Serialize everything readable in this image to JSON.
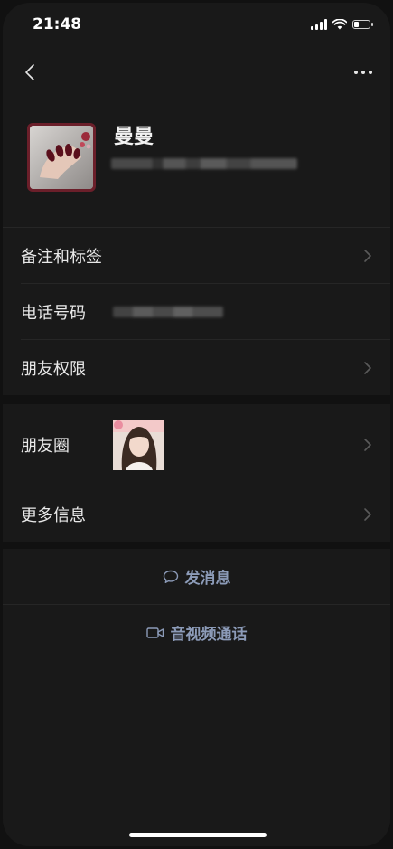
{
  "status_bar": {
    "time": "21:48"
  },
  "profile": {
    "name": "曼曼"
  },
  "list": {
    "remarks_label": "备注和标签",
    "phone_label": "电话号码",
    "friend_permissions_label": "朋友权限",
    "moments_label": "朋友圈",
    "more_info_label": "更多信息"
  },
  "actions": {
    "send_message_label": "发消息",
    "video_call_label": "音视频通话"
  },
  "colors": {
    "background": "#191919",
    "section_gap": "#111111",
    "action_text": "#8c9bb8",
    "text_primary": "#e8e8e8"
  },
  "icons": {
    "back": "chevron-left-icon",
    "more": "more-dots-icon",
    "chevron": "chevron-right-icon",
    "message": "speech-bubble-icon",
    "video": "video-camera-icon"
  }
}
